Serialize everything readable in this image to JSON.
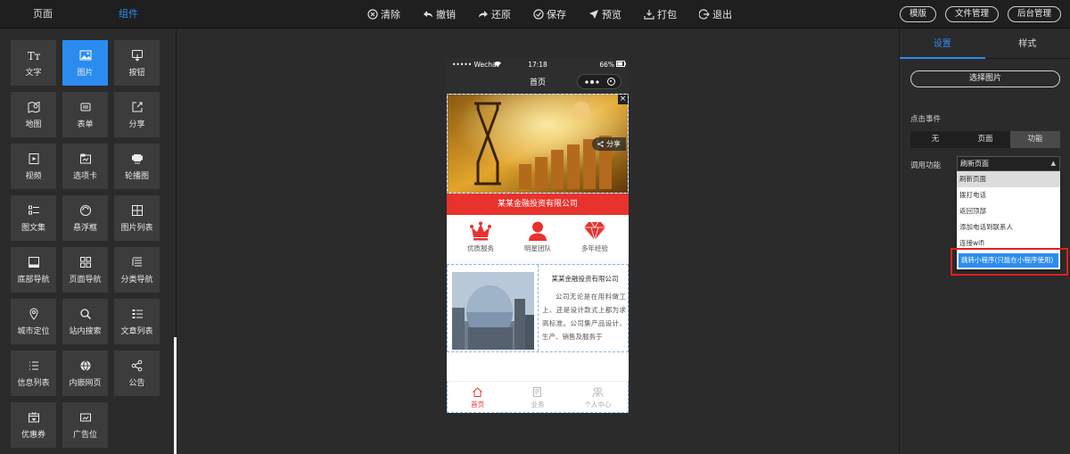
{
  "topbar": {
    "tabs": [
      "页面",
      "组件"
    ],
    "actions": [
      {
        "label": "清除",
        "icon": "clear-icon"
      },
      {
        "label": "撤销",
        "icon": "undo-icon"
      },
      {
        "label": "还原",
        "icon": "redo-icon"
      },
      {
        "label": "保存",
        "icon": "save-icon"
      },
      {
        "label": "预览",
        "icon": "preview-icon"
      },
      {
        "label": "打包",
        "icon": "package-icon"
      },
      {
        "label": "退出",
        "icon": "exit-icon"
      }
    ],
    "right_buttons": [
      "模版",
      "文件管理",
      "后台管理"
    ]
  },
  "components": [
    {
      "label": "文字",
      "icon": "text-icon"
    },
    {
      "label": "图片",
      "icon": "image-icon",
      "active": true
    },
    {
      "label": "按钮",
      "icon": "button-icon"
    },
    {
      "label": "地图",
      "icon": "map-icon"
    },
    {
      "label": "表单",
      "icon": "form-icon"
    },
    {
      "label": "分享",
      "icon": "share-icon"
    },
    {
      "label": "视频",
      "icon": "video-icon"
    },
    {
      "label": "选项卡",
      "icon": "tabs-icon"
    },
    {
      "label": "轮播图",
      "icon": "carousel-icon"
    },
    {
      "label": "图文集",
      "icon": "image-text-icon"
    },
    {
      "label": "悬浮框",
      "icon": "float-box-icon"
    },
    {
      "label": "图片列表",
      "icon": "image-list-icon"
    },
    {
      "label": "底部导航",
      "icon": "bottom-nav-icon"
    },
    {
      "label": "页面导航",
      "icon": "page-nav-icon"
    },
    {
      "label": "分类导航",
      "icon": "category-nav-icon"
    },
    {
      "label": "城市定位",
      "icon": "location-icon"
    },
    {
      "label": "站内搜索",
      "icon": "search-icon"
    },
    {
      "label": "文章列表",
      "icon": "article-list-icon"
    },
    {
      "label": "信息列表",
      "icon": "info-list-icon"
    },
    {
      "label": "内嵌网页",
      "icon": "webview-icon"
    },
    {
      "label": "公告",
      "icon": "announcement-icon"
    },
    {
      "label": "优惠券",
      "icon": "coupon-icon"
    },
    {
      "label": "广告位",
      "icon": "ad-icon"
    }
  ],
  "phone": {
    "status": {
      "carrier": "••••• Wechat",
      "time": "17:18",
      "battery": "66%"
    },
    "nav_title": "首页",
    "banner_share": "分享",
    "close": "×",
    "company": "某某金融投资有限公司",
    "features": [
      {
        "label": "优质服务",
        "icon": "crown-icon"
      },
      {
        "label": "明星团队",
        "icon": "person-icon"
      },
      {
        "label": "多年经验",
        "icon": "diamond-icon"
      }
    ],
    "article": {
      "title": "某某金融投资有限公司",
      "body": "公司无论是在用料做工上、还是设计款式上都为求高标准。公司集产品设计、生产、销售及服务于"
    },
    "tabs": [
      {
        "label": "首页",
        "icon": "home-icon",
        "active": true
      },
      {
        "label": "业务",
        "icon": "business-icon"
      },
      {
        "label": "个人中心",
        "icon": "user-center-icon"
      }
    ]
  },
  "settings": {
    "tabs": [
      "设置",
      "样式"
    ],
    "choose_image": "选择图片",
    "click_event_label": "点击事件",
    "event_options": [
      "无",
      "页面",
      "功能"
    ],
    "event_selected": "功能",
    "function_label": "调用功能",
    "function_selected": "刷新页面",
    "dropdown_options": [
      "刷新页面",
      "拨打电话",
      "返回顶部",
      "添加电话到联系人",
      "连接wifi",
      "跳转小程序(只能在小程序使用)"
    ]
  },
  "colors": {
    "accent": "#2b8cf0",
    "brand_red": "#e8322e",
    "highlight_box": "#e02020"
  }
}
